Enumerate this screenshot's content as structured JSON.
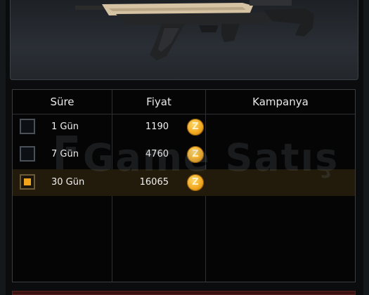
{
  "table": {
    "headers": {
      "duration": "Süre",
      "price": "Fiyat",
      "campaign": "Kampanya"
    },
    "rows": [
      {
        "duration": "1 Gün",
        "price": "1190",
        "checked": false
      },
      {
        "duration": "7 Gün",
        "price": "4760",
        "checked": false
      },
      {
        "duration": "30 Gün",
        "price": "16065",
        "checked": true
      }
    ],
    "coin_icon": "gold-coin-icon",
    "coin_glyph": "Z"
  },
  "watermark": {
    "text": "Game Satış"
  },
  "colors": {
    "accent": "#f2a51c",
    "selected_row": "#221a0b",
    "coin": "#f1a820"
  }
}
